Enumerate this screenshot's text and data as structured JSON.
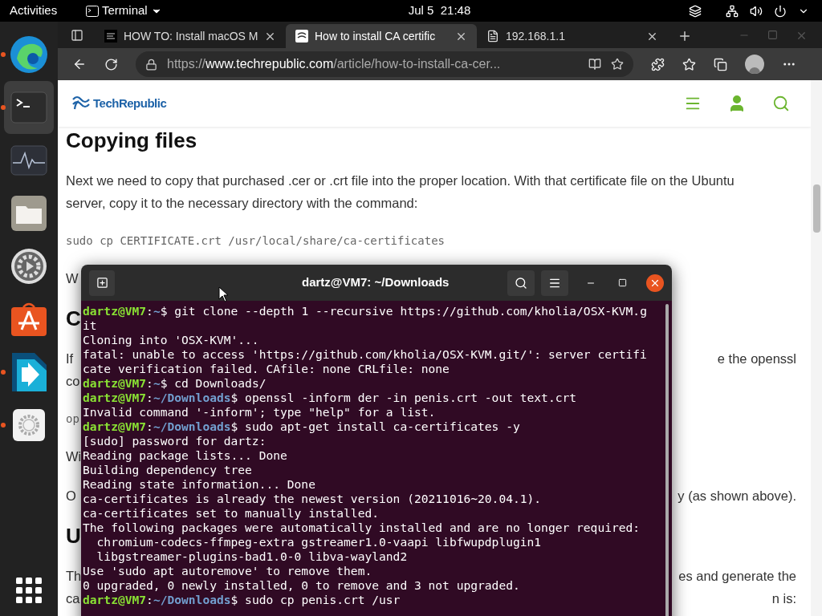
{
  "top_bar": {
    "activities": "Activities",
    "app_menu": "Terminal",
    "clock": "Jul 5  21:48"
  },
  "dock": {
    "items": [
      {
        "kind": "browser",
        "running": true,
        "selected": false
      },
      {
        "kind": "terminal",
        "running": true,
        "selected": true
      },
      {
        "kind": "monitor",
        "running": false,
        "selected": false
      },
      {
        "kind": "files",
        "running": false,
        "selected": false
      },
      {
        "kind": "gearplay",
        "running": false,
        "selected": false
      },
      {
        "kind": "store",
        "running": false,
        "selected": false
      },
      {
        "kind": "arrow",
        "running": true,
        "selected": false
      },
      {
        "kind": "settings",
        "running": true,
        "selected": false
      }
    ]
  },
  "browser": {
    "tabs": [
      {
        "title": "HOW TO: Install macOS M",
        "kind": "dark",
        "selected": false
      },
      {
        "title": "How to install CA certific",
        "kind": "flag",
        "selected": true
      },
      {
        "title": "192.168.1.1",
        "kind": "page",
        "selected": false
      }
    ],
    "url": {
      "scheme": "https://",
      "domain": "www.techrepublic.com",
      "path": "/article/how-to-install-ca-cer..."
    },
    "site": {
      "logo": "TechRepublic"
    },
    "article": [
      {
        "kind": "heading",
        "lines": [
          {
            "left": "Copying files"
          }
        ]
      },
      {
        "kind": "text",
        "lines": [
          {
            "left": "Next we need to copy that purchased .cer or .crt file into the proper location. With that certificate file on the Ubuntu"
          },
          {
            "left": "server, copy it to the necessary directory with the command:"
          }
        ]
      },
      {
        "kind": "code",
        "lines": [
          {
            "left": "sudo cp CERTIFICATE.crt /usr/local/share/ca-certificates"
          }
        ]
      },
      {
        "kind": "text",
        "lines": [
          {
            "left": "W"
          }
        ]
      },
      {
        "kind": "heading",
        "lines": [
          {
            "left": "C"
          }
        ]
      },
      {
        "kind": "text",
        "lines": [
          {
            "left": "If",
            "right": "e the openssl"
          },
          {
            "left": "co"
          }
        ]
      },
      {
        "kind": "code",
        "lines": [
          {
            "left": "op"
          }
        ]
      },
      {
        "kind": "text",
        "lines": [
          {
            "left": "Wi"
          }
        ]
      },
      {
        "kind": "text",
        "lines": [
          {
            "left": "O",
            "right": "y (as shown above)."
          }
        ]
      },
      {
        "kind": "heading",
        "lines": [
          {
            "left": "U"
          }
        ]
      },
      {
        "kind": "text",
        "lines": [
          {
            "left": "Th",
            "right": "es and generate the"
          },
          {
            "left": "ca",
            "right": "n is:"
          }
        ]
      }
    ]
  },
  "terminal": {
    "title": "dartz@VM7: ~/Downloads",
    "lines": [
      {
        "kind": "prompt",
        "user": "dartz@VM7",
        "path": "~",
        "sep": ":",
        "command": "$ git clone --depth 1 --recursive https://github.com/kholia/OSX-KVM.g"
      },
      {
        "kind": "output",
        "text": "it"
      },
      {
        "kind": "output",
        "text": "Cloning into 'OSX-KVM'..."
      },
      {
        "kind": "output",
        "text": "fatal: unable to access 'https://github.com/kholia/OSX-KVM.git/': server certifi"
      },
      {
        "kind": "output",
        "text": "cate verification failed. CAfile: none CRLfile: none"
      },
      {
        "kind": "prompt",
        "user": "dartz@VM7",
        "path": "~",
        "sep": ":",
        "command": "$ cd Downloads/"
      },
      {
        "kind": "prompt",
        "user": "dartz@VM7",
        "path": "~/Downloads",
        "sep": ":",
        "command": "$ openssl -inform der -in penis.crt -out text.crt"
      },
      {
        "kind": "output",
        "text": "Invalid command '-inform'; type \"help\" for a list."
      },
      {
        "kind": "prompt",
        "user": "dartz@VM7",
        "path": "~/Downloads",
        "sep": ":",
        "command": "$ sudo apt-get install ca-certificates -y"
      },
      {
        "kind": "output",
        "text": "[sudo] password for dartz:"
      },
      {
        "kind": "output",
        "text": "Reading package lists... Done"
      },
      {
        "kind": "output",
        "text": "Building dependency tree"
      },
      {
        "kind": "output",
        "text": "Reading state information... Done"
      },
      {
        "kind": "output",
        "text": "ca-certificates is already the newest version (20211016~20.04.1)."
      },
      {
        "kind": "output",
        "text": "ca-certificates set to manually installed."
      },
      {
        "kind": "output",
        "text": "The following packages were automatically installed and are no longer required:"
      },
      {
        "kind": "output",
        "text": "  chromium-codecs-ffmpeg-extra gstreamer1.0-vaapi libfwupdplugin1"
      },
      {
        "kind": "output",
        "text": "  libgstreamer-plugins-bad1.0-0 libva-wayland2"
      },
      {
        "kind": "output",
        "text": "Use 'sudo apt autoremove' to remove them."
      },
      {
        "kind": "output",
        "text": "0 upgraded, 0 newly installed, 0 to remove and 3 not upgraded."
      },
      {
        "kind": "prompt",
        "user": "dartz@VM7",
        "path": "~/Downloads",
        "sep": ":",
        "command": "$ sudo cp penis.crt /usr"
      }
    ]
  }
}
